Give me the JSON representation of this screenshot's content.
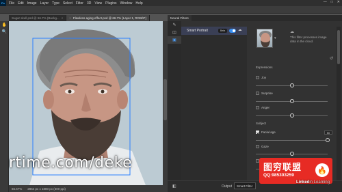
{
  "menubar": {
    "app_logo": "Ps",
    "items": [
      "File",
      "Edit",
      "Image",
      "Layer",
      "Type",
      "Select",
      "Filter",
      "3D",
      "View",
      "Plugins",
      "Window",
      "Help"
    ]
  },
  "tabs": [
    {
      "label": "Sugar skull.psd @ 66.7% (Backg...",
      "active": false
    },
    {
      "label": "Flawless aging effect.psd @ 66.7% (Layer 1, RGB/8*)",
      "active": true
    }
  ],
  "canvas": {
    "watermark": "rtime.com/deke"
  },
  "status": {
    "zoom": "66.67%",
    "doc_info": "2864 px x 1880 px (300 ppi)"
  },
  "neural": {
    "panel_tab": "Neural Filters",
    "filter_name": "Smart Portrait",
    "beta_badge": "Beta",
    "cloud_text": "This filter processes image data in the cloud.",
    "expressions_label": "Expressions",
    "subject_label": "Subject",
    "sliders": [
      {
        "label": "Joy",
        "checked": false,
        "value_fraction": 0.5
      },
      {
        "label": "Surprise",
        "checked": false,
        "value_fraction": 0.5
      },
      {
        "label": "Anger",
        "checked": false,
        "value_fraction": 0.5
      },
      {
        "label": "Facial age",
        "checked": true,
        "value_fraction": 1.0,
        "value_text": "50"
      },
      {
        "label": "Gaze",
        "checked": false,
        "value_fraction": 0.5
      },
      {
        "label": "Hair thickness",
        "checked": false,
        "value_fraction": 0.5
      }
    ],
    "output_label": "Output",
    "output_value": "Smart Filter"
  },
  "promo": {
    "title": "图穷联盟",
    "qq": "QQ:985303259",
    "logo_glyph": "🔥"
  },
  "branding": {
    "linkedin_a": "Linked",
    "linkedin_b": "in Learning"
  }
}
